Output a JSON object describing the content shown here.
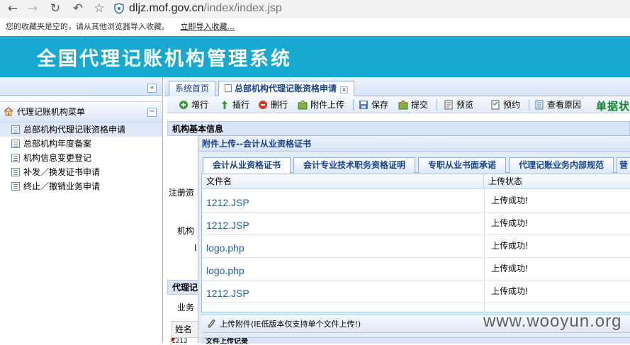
{
  "browser": {
    "url_host": "dljz.mof.gov.cn",
    "url_path": "/index/index.jsp",
    "bookmark_message": "您的收藏夹是空的，请从其他浏览器导入收藏。",
    "bookmark_import_link": "立即导入收藏..."
  },
  "header": {
    "title": "全国代理记账机构管理系统"
  },
  "sidebar": {
    "collapse_glyph": "«",
    "menu_title": "代理记账机构菜单",
    "minimize_glyph": "−",
    "items": [
      {
        "label": "总部机构代理记账资格申请",
        "active": true
      },
      {
        "label": "总部机构年度备案"
      },
      {
        "label": "机构信息变更登记"
      },
      {
        "label": "补发／换发证书申请"
      },
      {
        "label": "终止／撤销业务申请"
      }
    ]
  },
  "tabs": [
    {
      "label": "系统首页"
    },
    {
      "label": "总部机构代理记账资格申请",
      "active": true,
      "close_glyph": "x"
    }
  ],
  "toolbar": {
    "buttons": [
      {
        "label": "增行",
        "icon": "add-row-icon"
      },
      {
        "label": "插行",
        "icon": "insert-row-icon"
      },
      {
        "label": "删行",
        "icon": "delete-row-icon"
      },
      {
        "label": "附件上传",
        "icon": "attachment-upload-icon"
      },
      {
        "label": "保存",
        "icon": "save-icon"
      },
      {
        "label": "提交",
        "icon": "submit-icon"
      },
      {
        "label": "预览",
        "icon": "preview-icon"
      },
      {
        "label": "预约",
        "icon": "appointment-icon"
      },
      {
        "label": "查看原因",
        "icon": "view-reason-icon"
      }
    ],
    "status_label": "单据状"
  },
  "form": {
    "section_basic": "机构基本信息",
    "label_registered_capital": "注册资",
    "label_org": "机构",
    "label_small": "I",
    "section_agent": "代理记",
    "label_business": "业务",
    "col_name": "姓名",
    "row_fragment": "1212"
  },
  "dialog": {
    "title": "附件上传--会计从业资格证书",
    "tabs": [
      {
        "label": "会计从业资格证书",
        "active": true
      },
      {
        "label": "会计专业技术职务资格证明"
      },
      {
        "label": "专职从业书面承诺"
      },
      {
        "label": "代理记账业务内部规范"
      },
      {
        "label": "营"
      }
    ],
    "columns": {
      "file_name": "文件名",
      "upload_status": "上传状态"
    },
    "rows": [
      {
        "file_name": "1212.JSP",
        "status": "上传成功!"
      },
      {
        "file_name": "1212.JSP",
        "status": "上传成功!"
      },
      {
        "file_name": "logo.php",
        "status": "上传成功!"
      },
      {
        "file_name": "logo.php",
        "status": "上传成功!"
      },
      {
        "file_name": "1212.JSP",
        "status": "上传成功!"
      }
    ],
    "upload_button": "上传附件(IE低版本仅支持单个文件上传!)",
    "footer_fragment": "文件上传记录"
  },
  "watermark": "www.wooyun.org"
}
